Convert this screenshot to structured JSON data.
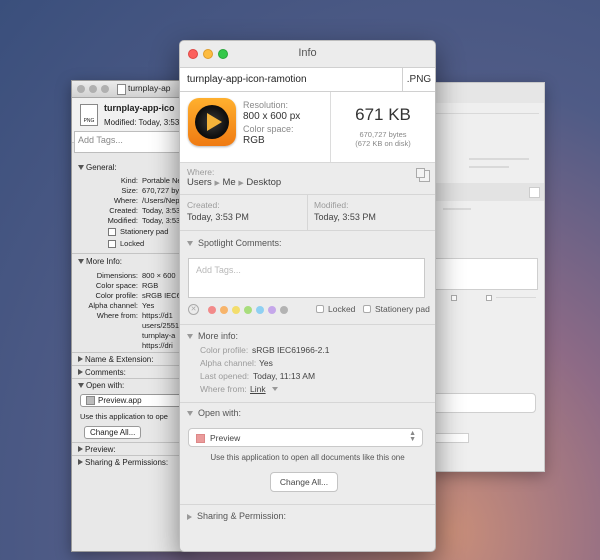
{
  "old_window": {
    "title": "turnplay-ap",
    "file_name": "turnplay-app-ico",
    "modified": "Modified: Today, 3:53",
    "icon_badge": "PNG",
    "tags_placeholder": "Add Tags...",
    "general_header": "General:",
    "general_rows": [
      {
        "label": "Kind:",
        "value": "Portable Network"
      },
      {
        "label": "Size:",
        "value": "670,727 bytes (6"
      },
      {
        "label": "Where:",
        "value": "/Users/Nep/Desk"
      },
      {
        "label": "Created:",
        "value": "Today, 3:53 PM"
      },
      {
        "label": "Modified:",
        "value": "Today, 3:53 PM"
      }
    ],
    "stationery": "Stationery pad",
    "locked": "Locked",
    "more_info_header": "More Info:",
    "more_rows": [
      {
        "label": "Dimensions:",
        "value": "800 × 600"
      },
      {
        "label": "Color space:",
        "value": "RGB"
      },
      {
        "label": "Color profile:",
        "value": "sRGB IEC61"
      },
      {
        "label": "Alpha channel:",
        "value": "Yes"
      },
      {
        "label": "Where from:",
        "value": "https://d1"
      }
    ],
    "where_from_extra": [
      "users/2551",
      "turnplay-a",
      "https://dri"
    ],
    "name_ext_header": "Name & Extension:",
    "comments_header": "Comments:",
    "open_with_header": "Open with:",
    "open_app": "Preview.app",
    "open_desc": "Use this application to ope",
    "change_all": "Change All...",
    "preview_header": "Preview:",
    "sharing_header": "Sharing & Permissions:"
  },
  "main": {
    "window_title": "Info",
    "file_name": "turnplay-app-icon-ramotion",
    "extension": ".PNG",
    "resolution_label": "Resolution:",
    "resolution_value": "800 x 600 px",
    "color_space_label": "Color space:",
    "color_space_value": "RGB",
    "size_big": "671 KB",
    "size_bytes": "670,727 bytes",
    "size_disk": "(672 KB on disk)",
    "where_label": "Where:",
    "path": [
      "Users",
      "Me",
      "Desktop"
    ],
    "created_label": "Created:",
    "created_value": "Today, 3:53 PM",
    "modified_label": "Modified:",
    "modified_value": "Today, 3:53 PM",
    "spotlight_header": "Spotlight Comments:",
    "tags_placeholder": "Add Tags...",
    "tag_colors": [
      "#f28a8a",
      "#f7b46b",
      "#f3dd6c",
      "#a8dd7c",
      "#8fd0f2",
      "#c5a7ea",
      "#b3b3b3"
    ],
    "locked_label": "Locked",
    "stationery_label": "Stationery pad",
    "more_info_header": "More info:",
    "color_profile_label": "Color profile:",
    "color_profile_value": "sRGB IEC61966-2.1",
    "alpha_label": "Alpha channel:",
    "alpha_value": "Yes",
    "last_opened_label": "Last opened:",
    "last_opened_value": "Today, 11:13 AM",
    "where_from_label": "Where from:",
    "where_from_value": "Link",
    "open_with_header": "Open with:",
    "open_app": "Preview",
    "open_desc": "Use this application to open all documents like this one",
    "change_all": "Change All...",
    "sharing_header": "Sharing & Permission:"
  }
}
